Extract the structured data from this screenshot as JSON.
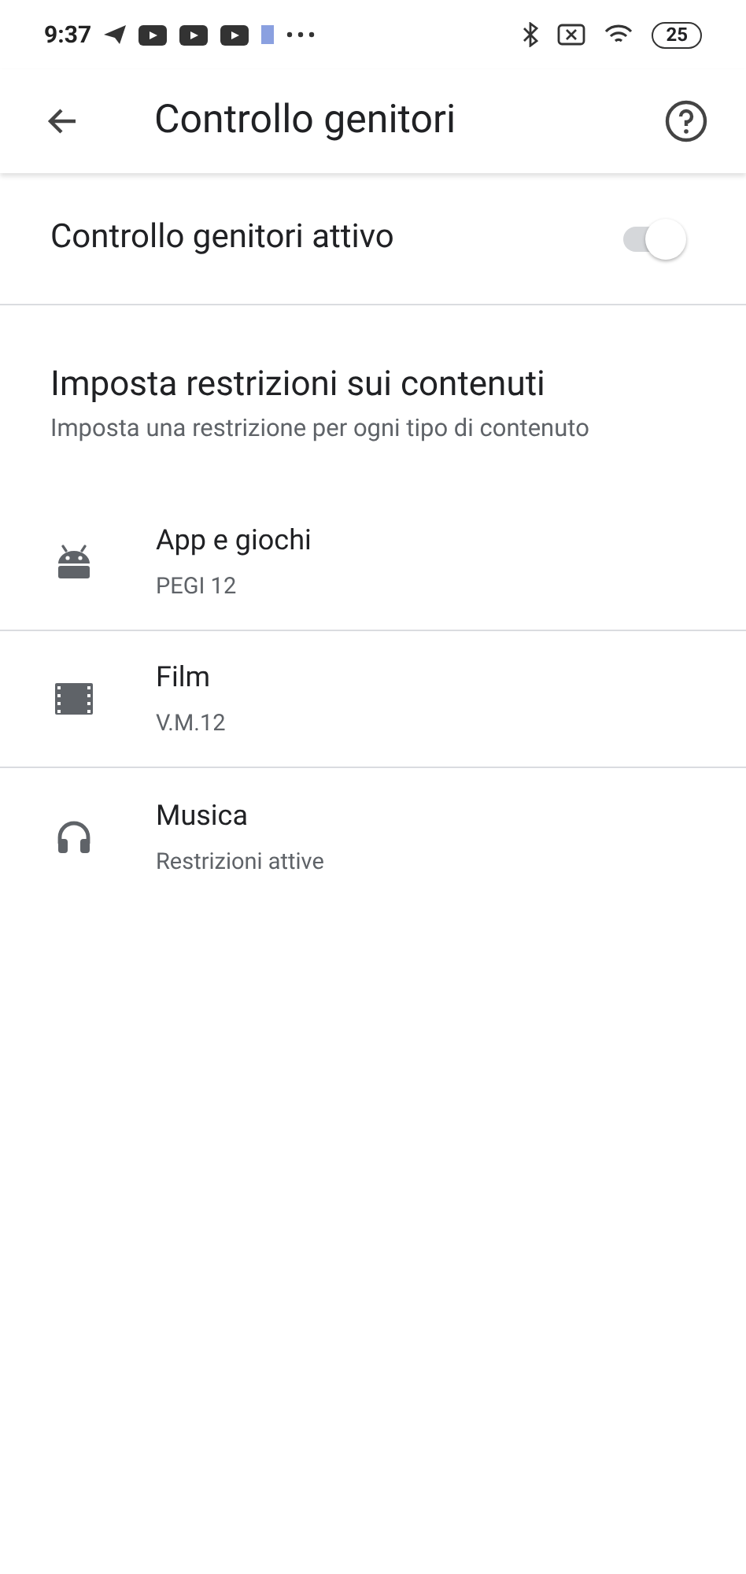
{
  "status_bar": {
    "time": "9:37",
    "battery": "25"
  },
  "app_bar": {
    "title": "Controllo genitori"
  },
  "master_switch": {
    "label": "Controllo genitori attivo",
    "on": true
  },
  "section": {
    "title": "Imposta restrizioni sui contenuti",
    "subtitle": "Imposta una restrizione per ogni tipo di contenuto"
  },
  "items": [
    {
      "kind": "apps",
      "title": "App e giochi",
      "summary": "PEGI 12"
    },
    {
      "kind": "film",
      "title": "Film",
      "summary": "V.M.12"
    },
    {
      "kind": "music",
      "title": "Musica",
      "summary": "Restrizioni attive"
    }
  ]
}
